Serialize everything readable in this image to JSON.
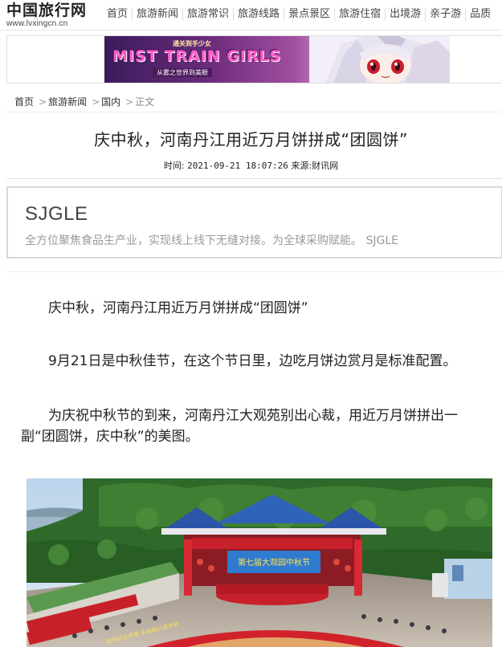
{
  "header": {
    "logo_text": "中国旅行网",
    "logo_url": "www.lvxingcn.cn",
    "nav": [
      "首页",
      "旅游新闻",
      "旅游常识",
      "旅游线路",
      "景点景区",
      "旅游住宿",
      "出境游",
      "亲子游",
      "品质"
    ]
  },
  "banner": {
    "small_text": "通关到手少女",
    "title": "MIST TRAIN GIRLS",
    "subtitle": "从雾之世界到美眼"
  },
  "breadcrumb": {
    "items": [
      "首页",
      "旅游新闻",
      "国内"
    ],
    "current": "正文"
  },
  "article": {
    "title": "庆中秋，河南丹江用近万月饼拼成“团圆饼”",
    "meta_time_label": "时间:",
    "meta_time": "2021-09-21 18:07:26",
    "meta_source_label": "来源:",
    "meta_source": "财讯网",
    "paragraphs": [
      "庆中秋，河南丹江用近万月饼拼成“团圆饼”",
      "9月21日是中秋佳节，在这个节日里，边吃月饼边赏月是标准配置。",
      "为庆祝中秋节的到来，河南丹江大观苑别出心裁，用近万月饼拼出一副“团圆饼，庆中秋”的美图。"
    ]
  },
  "ad": {
    "title": "SJGLE",
    "description": "全方位聚焦食品生产业，实现线上线下无缝对接。为全球采购赋能。 SJGLE"
  },
  "photo": {
    "stage_banner": "第七届大观园中秋节",
    "left_banner": "团月好花齐赏 乡村振兴庆丰收"
  }
}
